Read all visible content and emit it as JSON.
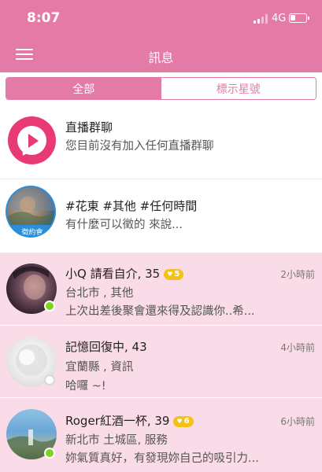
{
  "status_bar": {
    "time": "8:07",
    "network": "4G",
    "battery_level": 0.35
  },
  "header": {
    "title": "訊息",
    "menu_icon": "hamburger-menu-icon"
  },
  "tabs": [
    {
      "label": "全部",
      "active": true
    },
    {
      "label": "標示星號",
      "active": false
    }
  ],
  "live_group": {
    "icon": "live-chat-play-icon",
    "title": "直播群聊",
    "subtitle": "您目前沒有加入任何直播群聊"
  },
  "date_post": {
    "avatar_label": "徵約會",
    "tags": "#花東 #其他 #任何時間",
    "message": "有什麼可以徵的 來說..."
  },
  "conversations": [
    {
      "name": "小Q 請看自介, 35",
      "badge": "5",
      "location": "台北市 , 其他",
      "message": "上次出差後聚會還來得及認識你..希...",
      "time": "2小時前",
      "online": true
    },
    {
      "name": "記憶回復中, 43",
      "badge": "",
      "location": "宜蘭縣 , 資訊",
      "message": "哈囉 ~!",
      "time": "4小時前",
      "online": false
    },
    {
      "name": "Roger紅酒一杯, 39",
      "badge": "6",
      "location": "新北市 土城區, 服務",
      "message": "妳氣質真好，有發現妳自己的吸引力...",
      "time": "6小時前",
      "online": true
    }
  ],
  "colors": {
    "brand_pink": "#e47aa6",
    "live_red": "#e83a73",
    "unread_row": "#f9dce8",
    "online_green": "#7ed321",
    "badge_gold": "#f2c21b"
  }
}
